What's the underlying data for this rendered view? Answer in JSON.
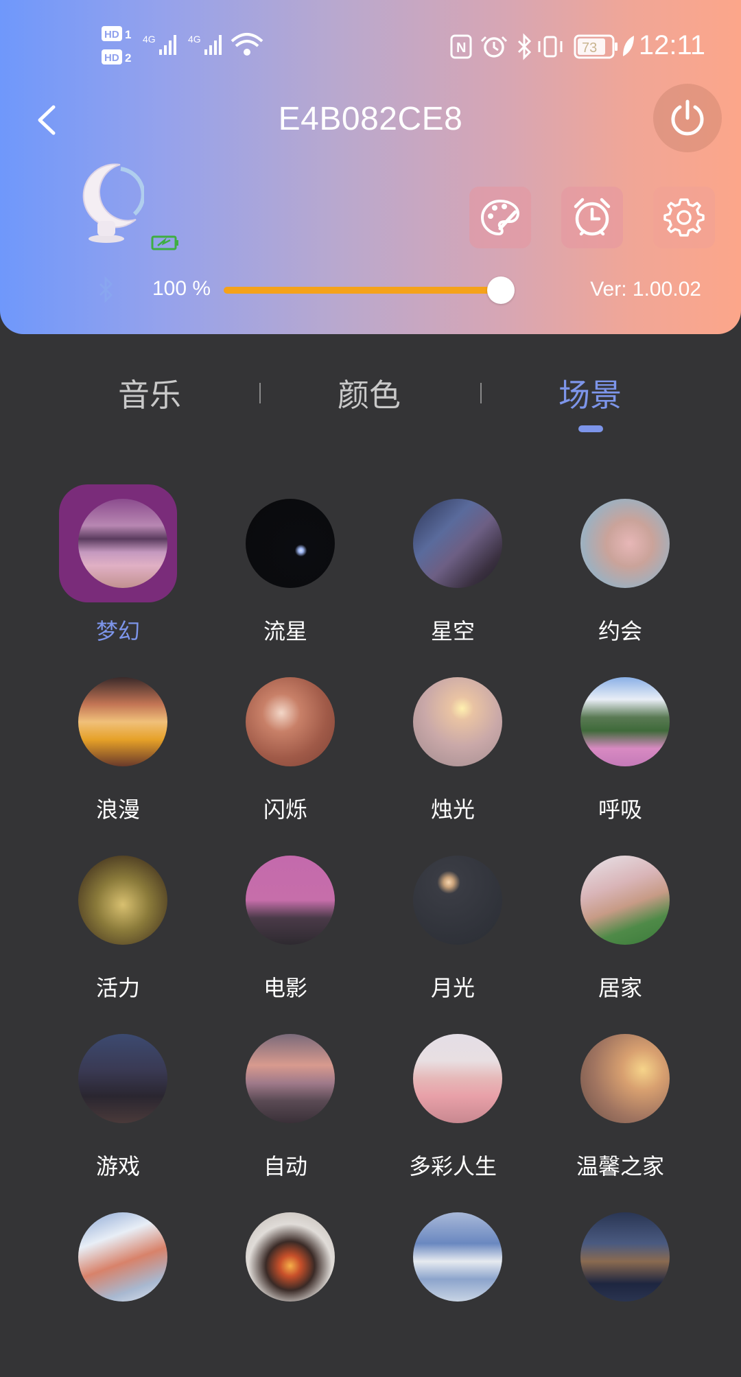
{
  "status_bar": {
    "time": "12:11",
    "battery": "73"
  },
  "header": {
    "title": "E4B082CE8",
    "brightness": "100 %",
    "brightness_value": 100,
    "version": "Ver:  1.00.02"
  },
  "tabs": [
    {
      "label": "音乐"
    },
    {
      "label": "颜色"
    },
    {
      "label": "场景",
      "active": true
    }
  ],
  "scenes": [
    {
      "label": "梦幻",
      "selected": true
    },
    {
      "label": "流星"
    },
    {
      "label": "星空"
    },
    {
      "label": "约会"
    },
    {
      "label": "浪漫"
    },
    {
      "label": "闪烁"
    },
    {
      "label": "烛光"
    },
    {
      "label": "呼吸"
    },
    {
      "label": "活力"
    },
    {
      "label": "电影"
    },
    {
      "label": "月光"
    },
    {
      "label": "居家"
    },
    {
      "label": "游戏"
    },
    {
      "label": "自动"
    },
    {
      "label": "多彩人生"
    },
    {
      "label": "温馨之家"
    },
    {
      "label": ""
    },
    {
      "label": ""
    },
    {
      "label": ""
    },
    {
      "label": ""
    }
  ],
  "colors": {
    "accent": "#7d95ea",
    "slider": "#f5a21a",
    "background": "#343436"
  }
}
